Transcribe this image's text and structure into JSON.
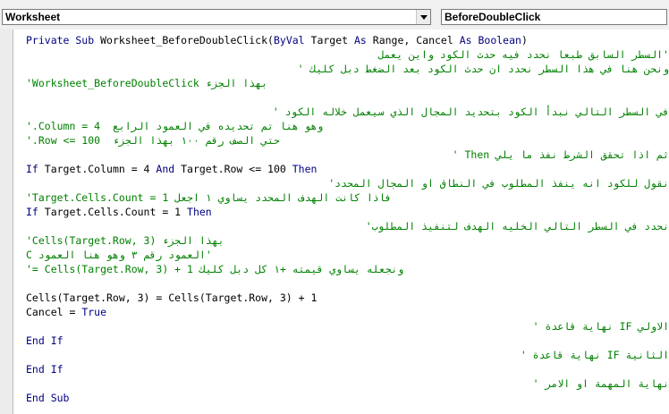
{
  "toolbar": {
    "object_combo": "Worksheet",
    "procedure_combo": "BeforeDoubleClick"
  },
  "colors": {
    "keyword": "#000080",
    "comment": "#008000",
    "text": "#000000"
  },
  "code_lines": [
    {
      "kind": "code",
      "segments": [
        {
          "t": "kw",
          "v": "Private Sub "
        },
        {
          "t": "tx",
          "v": "Worksheet_BeforeDoubleClick("
        },
        {
          "t": "kw",
          "v": "ByVal "
        },
        {
          "t": "tx",
          "v": "Target "
        },
        {
          "t": "kw",
          "v": "As "
        },
        {
          "t": "tx",
          "v": "Range, Cancel "
        },
        {
          "t": "kw",
          "v": "As Boolean"
        },
        {
          "t": "tx",
          "v": ")"
        }
      ]
    },
    {
      "kind": "comment",
      "text": "'السطر السابق طبعا نحدد فيه حدث الكود واين يعمل"
    },
    {
      "kind": "comment",
      "text": "ونحن هنا في هذا السطر نحدد ان حدث الكود بعد الضغط دبل كليك '"
    },
    {
      "kind": "comment",
      "text": "'Worksheet_BeforeDoubleClick بهذا الجزء"
    },
    {
      "kind": "blank"
    },
    {
      "kind": "comment",
      "text": "في السطر التالي نبدأ الكود بتحديد المجال الذي سيعمل خلاله الكود '"
    },
    {
      "kind": "comment",
      "text": "'.Column = 4  وهو هنا تم تحديده في العمود الرابع"
    },
    {
      "kind": "comment",
      "text": "'.Row <= 100  حتي الصف رقم ١٠٠ بهذا الجزء"
    },
    {
      "kind": "comment",
      "text": "ثم اذا تحقق الشرط نفذ ما يلي Then '"
    },
    {
      "kind": "code",
      "segments": [
        {
          "t": "kw",
          "v": "If "
        },
        {
          "t": "tx",
          "v": "Target.Column = 4 "
        },
        {
          "t": "kw",
          "v": "And "
        },
        {
          "t": "tx",
          "v": "Target.Row <= 100 "
        },
        {
          "t": "kw",
          "v": "Then"
        }
      ]
    },
    {
      "kind": "comment",
      "text": "نقول للكود انه ينفذ المطلوب في النطاق او المجال المحدد'"
    },
    {
      "kind": "comment",
      "text": "'Target.Cells.Count = 1 فاذا كانت الهدف المحدد يساوي ١ اجعل"
    },
    {
      "kind": "code",
      "segments": [
        {
          "t": "kw",
          "v": "If "
        },
        {
          "t": "tx",
          "v": "Target.Cells.Count = 1 "
        },
        {
          "t": "kw",
          "v": "Then"
        }
      ]
    },
    {
      "kind": "comment",
      "text": "نحدد في السطر التالي الخليه الهدف لتنفيذ المطلوب'"
    },
    {
      "kind": "comment",
      "text": "'Cells(Target.Row, 3) بهذا الجزء"
    },
    {
      "kind": "comment",
      "text": "C العمود رقم ٣ وهو هنا العمود'"
    },
    {
      "kind": "comment",
      "text": "'= Cells(Target.Row, 3) + 1 ونجعله يساوي قيمته +١ كل دبل كليك"
    },
    {
      "kind": "blank"
    },
    {
      "kind": "code",
      "segments": [
        {
          "t": "tx",
          "v": "Cells(Target.Row, 3) = Cells(Target.Row, 3) + 1"
        }
      ]
    },
    {
      "kind": "code",
      "segments": [
        {
          "t": "tx",
          "v": "Cancel = "
        },
        {
          "t": "kw",
          "v": "True"
        }
      ]
    },
    {
      "kind": "comment",
      "text": "الاولي IF نهاية قاعدة '"
    },
    {
      "kind": "code",
      "segments": [
        {
          "t": "kw",
          "v": "End If"
        }
      ]
    },
    {
      "kind": "comment",
      "text": "الثانية IF نهاية قاعدة '"
    },
    {
      "kind": "code",
      "segments": [
        {
          "t": "kw",
          "v": "End If"
        }
      ]
    },
    {
      "kind": "comment",
      "text": "نهاية المهمة او الامر '"
    },
    {
      "kind": "code",
      "segments": [
        {
          "t": "kw",
          "v": "End Sub"
        }
      ]
    }
  ]
}
